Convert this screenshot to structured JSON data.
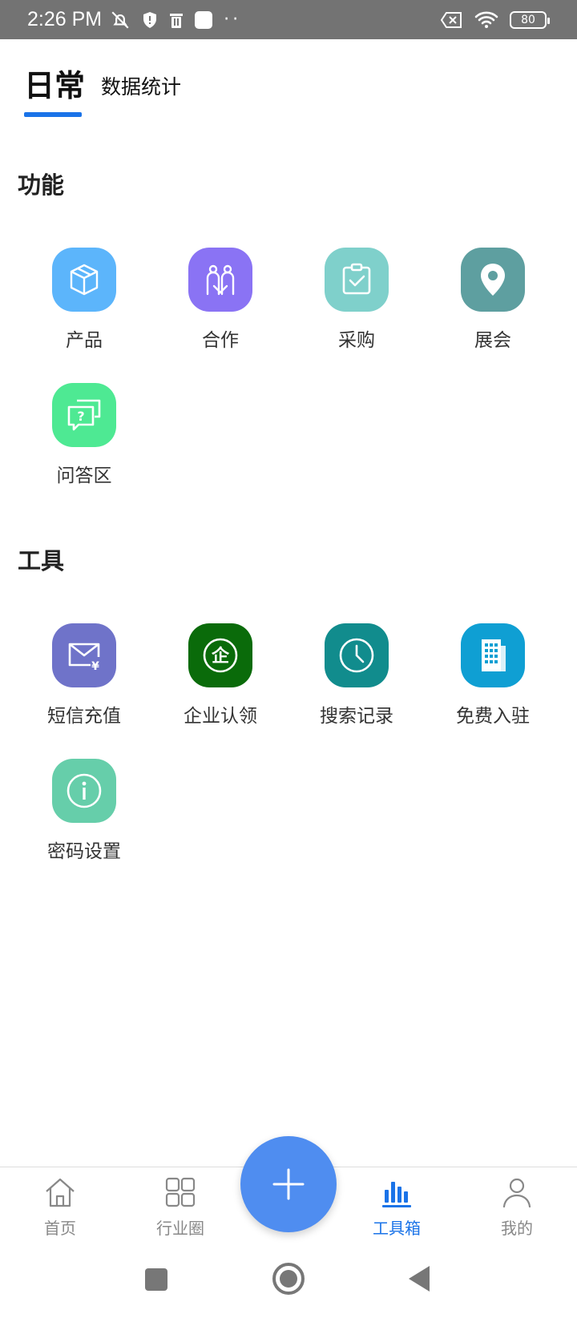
{
  "status_bar": {
    "time": "2:26 PM",
    "battery": "80"
  },
  "tabs": {
    "active": "日常",
    "inactive": "数据统计"
  },
  "sections": {
    "functions": {
      "title": "功能",
      "items": [
        {
          "label": "产品",
          "icon": "box-icon",
          "color": "#5cb5fb"
        },
        {
          "label": "合作",
          "icon": "partners-icon",
          "color": "#8a73f4"
        },
        {
          "label": "采购",
          "icon": "clipboard-check-icon",
          "color": "#7fd0cb"
        },
        {
          "label": "展会",
          "icon": "location-pin-icon",
          "color": "#5e9fa0"
        },
        {
          "label": "问答区",
          "icon": "chat-question-icon",
          "color": "#4ee993"
        }
      ]
    },
    "tools": {
      "title": "工具",
      "items": [
        {
          "label": "短信充值",
          "icon": "mail-yen-icon",
          "color": "#6f73c9"
        },
        {
          "label": "企业认领",
          "icon": "enterprise-seal-icon",
          "color": "#0a6b0a"
        },
        {
          "label": "搜索记录",
          "icon": "clock-icon",
          "color": "#118c8d"
        },
        {
          "label": "免费入驻",
          "icon": "building-icon",
          "color": "#0f9fd3"
        },
        {
          "label": "密码设置",
          "icon": "info-icon",
          "color": "#66ceaa"
        }
      ]
    }
  },
  "bottom_nav": {
    "items": [
      {
        "label": "首页",
        "icon": "home-icon"
      },
      {
        "label": "行业圈",
        "icon": "grid-icon"
      },
      {
        "label": "工具箱",
        "icon": "bar-chart-icon",
        "active": true
      },
      {
        "label": "我的",
        "icon": "user-icon"
      }
    ],
    "accent": "#1a73e8"
  }
}
